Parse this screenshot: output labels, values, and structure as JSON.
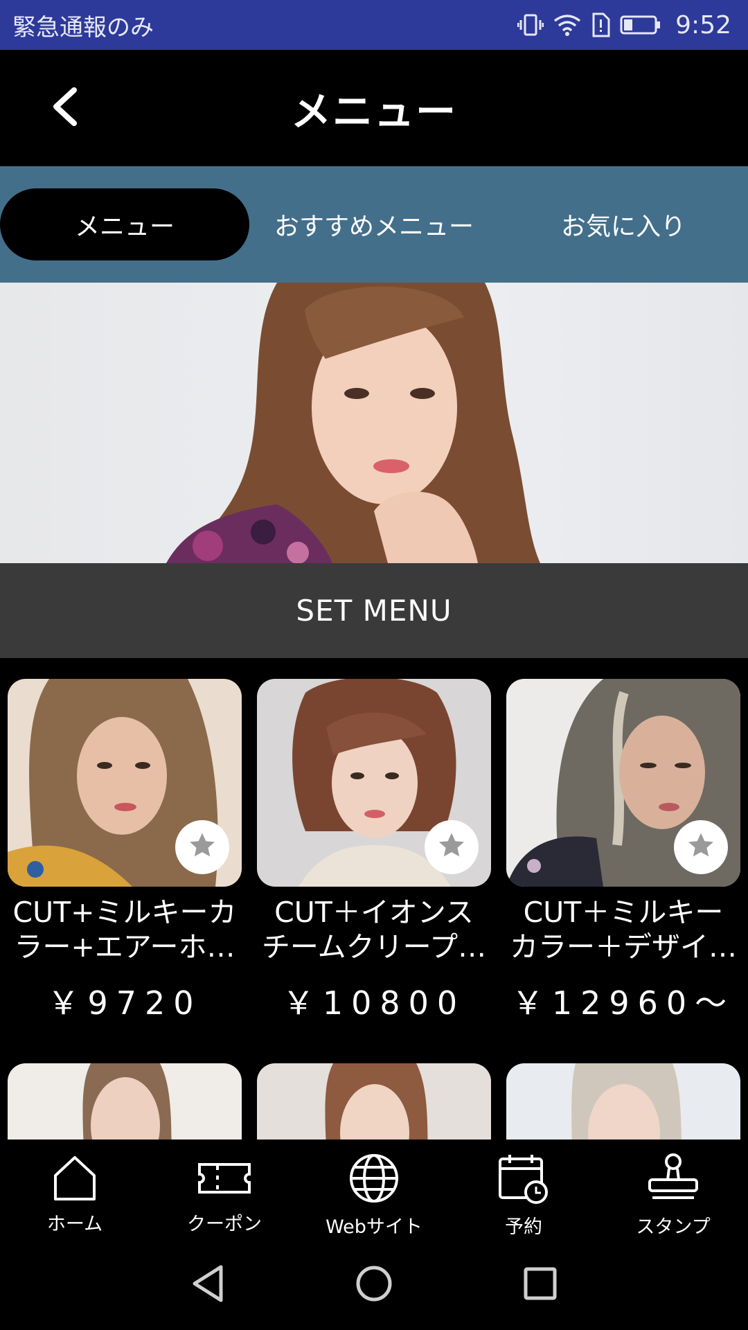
{
  "status_bar": {
    "carrier_text": "緊急通報のみ",
    "time": "9:52",
    "icons": [
      "vibrate-icon",
      "wifi-icon",
      "alert-sim-icon",
      "battery-icon"
    ]
  },
  "app_bar": {
    "title": "メニュー",
    "back_icon": "chevron-left-icon"
  },
  "tabs": [
    {
      "label": "メニュー",
      "active": true
    },
    {
      "label": "おすすめメニュー",
      "active": false
    },
    {
      "label": "お気に入り",
      "active": false
    }
  ],
  "section": {
    "title": "SET MENU"
  },
  "items": [
    {
      "name": "CUT+ミルキーカ\nラー+エアーホ…",
      "price": "￥9720",
      "favorite_icon": "star-icon"
    },
    {
      "name": "CUT＋イオンス\nチームクリープ…",
      "price": "￥10800",
      "favorite_icon": "star-icon"
    },
    {
      "name": "CUT＋ミルキー\nカラー＋デザイ…",
      "price": "￥12960～",
      "favorite_icon": "star-icon"
    }
  ],
  "bottom_nav": [
    {
      "label": "ホーム",
      "icon": "home-icon"
    },
    {
      "label": "クーポン",
      "icon": "ticket-icon"
    },
    {
      "label": "Webサイト",
      "icon": "globe-icon"
    },
    {
      "label": "予約",
      "icon": "calendar-clock-icon"
    },
    {
      "label": "スタンプ",
      "icon": "stamp-icon"
    }
  ],
  "colors": {
    "status_bar": "#2d3a9a",
    "tab_bar": "#436f8b",
    "section_header": "#3a3a3a",
    "background": "#000000"
  }
}
